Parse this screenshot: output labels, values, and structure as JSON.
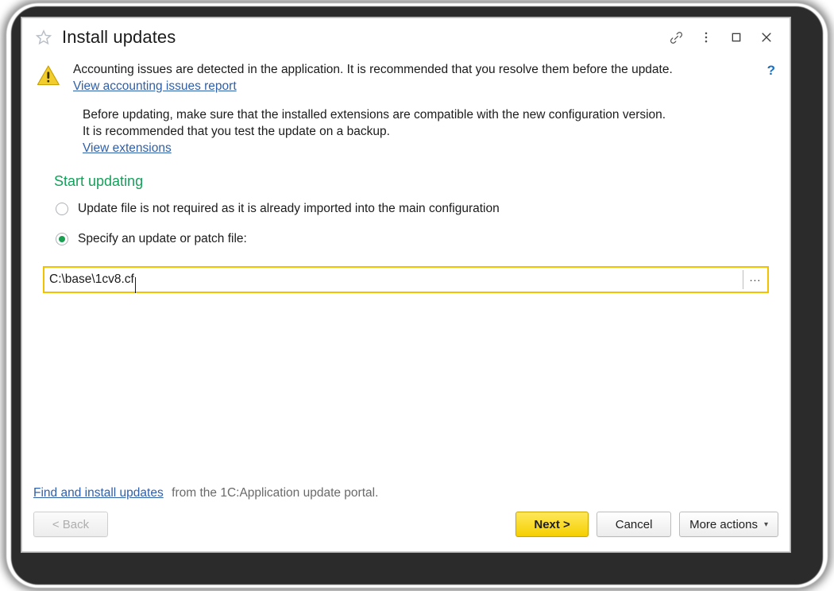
{
  "window": {
    "title": "Install updates",
    "favorite_icon": "star-icon",
    "titlebar_buttons": [
      {
        "name": "link-icon",
        "label": ""
      },
      {
        "name": "more-options-icon",
        "label": ""
      },
      {
        "name": "maximize-icon",
        "label": ""
      },
      {
        "name": "close-icon",
        "label": ""
      }
    ]
  },
  "warning": {
    "icon": "warning-triangle-icon",
    "message": "Accounting issues are detected in the application. It is recommended that you resolve them before the update.",
    "report_link": "View accounting issues report",
    "help_icon": "?"
  },
  "extensions": {
    "line1": "Before updating, make sure that the installed extensions are compatible with the new configuration version.",
    "line2": "It is recommended that you test the update on a backup.",
    "link": "View extensions"
  },
  "section": {
    "heading": "Start updating",
    "heading_color": "#16a05b"
  },
  "options": [
    {
      "id": "imported",
      "label": "Update file is not required as it is already imported into the main configuration",
      "selected": false
    },
    {
      "id": "specify",
      "label": "Specify an update or patch file:",
      "selected": true
    }
  ],
  "file_field": {
    "value": "C:\\base\\1cv8.cf",
    "placeholder": "",
    "browse_label": "...",
    "focused": true,
    "focus_color": "#f2c200"
  },
  "footer": {
    "portal_link": "Find and install updates",
    "portal_note": "from the 1C:Application update portal.",
    "buttons": {
      "back": "< Back",
      "next": "Next >",
      "cancel": "Cancel",
      "more_actions": "More actions",
      "more_actions_caret": "▾"
    },
    "next_color": "#f5cf00",
    "back_disabled": true
  }
}
